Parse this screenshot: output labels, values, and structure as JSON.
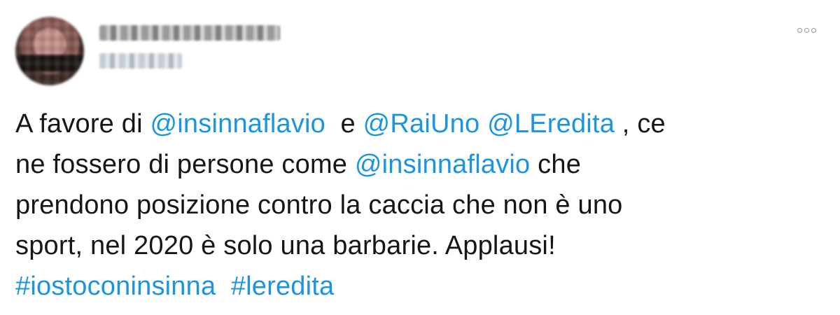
{
  "tweet": {
    "more_icon": "more-options-icon",
    "colors": {
      "text": "#14171a",
      "link": "#1b95e0",
      "icon": "#8899a6"
    },
    "line1": {
      "t1": "A favore di ",
      "m1": "@insinnaflavio",
      "t2": "  e ",
      "m2": "@RaiUno",
      "t3": " ",
      "m3": "@LEredita",
      "t4": " , ce"
    },
    "line2": {
      "t1": "ne fossero di persone come ",
      "m1": "@insinnaflavio",
      "t2": " che"
    },
    "line3": {
      "t1": "prendono posizione contro la caccia che non è uno"
    },
    "line4": {
      "t1": "sport, nel 2020 è solo una barbarie. Applausi!"
    },
    "line5": {
      "h1": "#iostoconinsinna",
      "t1": "  ",
      "h2": "#leredita"
    }
  }
}
